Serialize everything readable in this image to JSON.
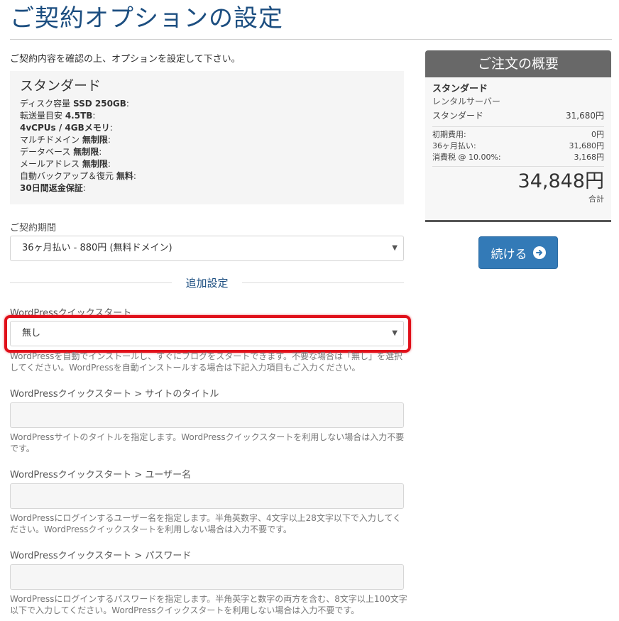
{
  "page": {
    "title": "ご契約オプションの設定",
    "intro": "ご契約内容を確認の上、オプションを設定して下さい。"
  },
  "plan": {
    "name": "スタンダード",
    "specs": [
      {
        "label": "ディスク容量 ",
        "value": "SSD 250GB",
        "suffix": ":"
      },
      {
        "label": "転送量目安 ",
        "value": "4.5TB",
        "suffix": ":"
      },
      {
        "label": "",
        "value": "4vCPUs / 4GBメモリ",
        "suffix": ":"
      },
      {
        "label": "マルチドメイン ",
        "value": "無制限",
        "suffix": ":"
      },
      {
        "label": "データベース ",
        "value": "無制限",
        "suffix": ":"
      },
      {
        "label": "メールアドレス ",
        "value": "無制限",
        "suffix": ":"
      },
      {
        "label": "自動バックアップ＆復元 ",
        "value": "無料",
        "suffix": ":"
      },
      {
        "label": "",
        "value": "30日間返金保証",
        "suffix": ":"
      }
    ]
  },
  "billing": {
    "label": "ご契約期間",
    "selected": "36ヶ月払い - 880円 (無料ドメイン)"
  },
  "section": {
    "title": "追加設定"
  },
  "wp_quickstart": {
    "label": "WordPressクイックスタート",
    "selected": "無し",
    "help": "WordPressを自動でインストールし、すぐにブログをスタートできます。不要な場合は「無し」を選択してください。WordPressを自動インストールする場合は下記入力項目もご入力ください。"
  },
  "site_title": {
    "label": "WordPressクイックスタート > サイトのタイトル",
    "value": "",
    "help": "WordPressサイトのタイトルを指定します。WordPressクイックスタートを利用しない場合は入力不要です。"
  },
  "username": {
    "label": "WordPressクイックスタート > ユーザー名",
    "value": "",
    "help": "WordPressにログインするユーザー名を指定します。半角英数字、4文字以上28文字以下で入力してください。WordPressクイックスタートを利用しない場合は入力不要です。"
  },
  "password": {
    "label": "WordPressクイックスタート > パスワード",
    "value": "",
    "help": "WordPressにログインするパスワードを指定します。半角英字と数字の両方を含む、8文字以上100文字以下で入力してください。WordPressクイックスタートを利用しない場合は入力不要です。"
  },
  "summary": {
    "header": "ご注文の概要",
    "plan_name": "スタンダード",
    "plan_sub": "レンタルサーバー",
    "plan_line": {
      "label": "スタンダード",
      "value": "31,680円"
    },
    "rows": [
      {
        "label": "初期費用:",
        "value": "0円"
      },
      {
        "label": "36ヶ月払い:",
        "value": "31,680円"
      },
      {
        "label": "消費税 @ 10.00%:",
        "value": "3,168円"
      }
    ],
    "total": "34,848円",
    "total_label": "合計"
  },
  "actions": {
    "continue_label": "続ける"
  },
  "colors": {
    "accent": "#337ab7",
    "title": "#1c4e80",
    "highlight": "#e0101a"
  }
}
